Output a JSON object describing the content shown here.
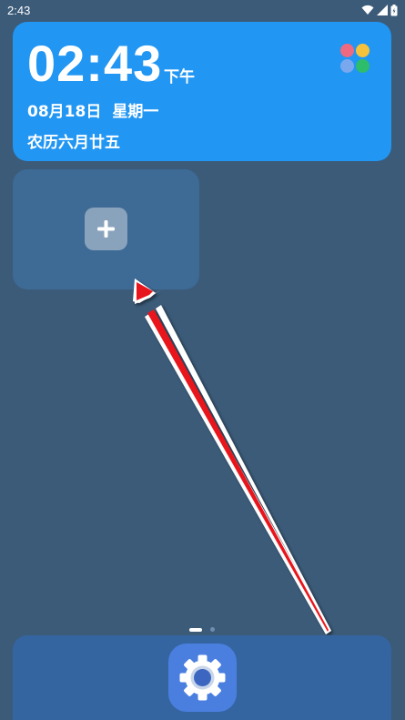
{
  "status_bar": {
    "time": "2:43",
    "icons": [
      "wifi-icon",
      "signal-icon",
      "battery-icon"
    ]
  },
  "clock_widget": {
    "time": "02:43",
    "ampm": "下午",
    "date": "08月18日",
    "weekday": "星期一",
    "lunar_date": "农历六月廿五",
    "app_icon": "four-petal-flower-icon",
    "background_color": "#2196f3"
  },
  "add_widget": {
    "icon": "plus-icon"
  },
  "page_indicator": {
    "pages": 2,
    "current": 1
  },
  "dock": {
    "apps": [
      {
        "icon": "settings-gear-icon"
      }
    ]
  },
  "annotation": {
    "type": "arrow",
    "color": "#e8141c"
  }
}
